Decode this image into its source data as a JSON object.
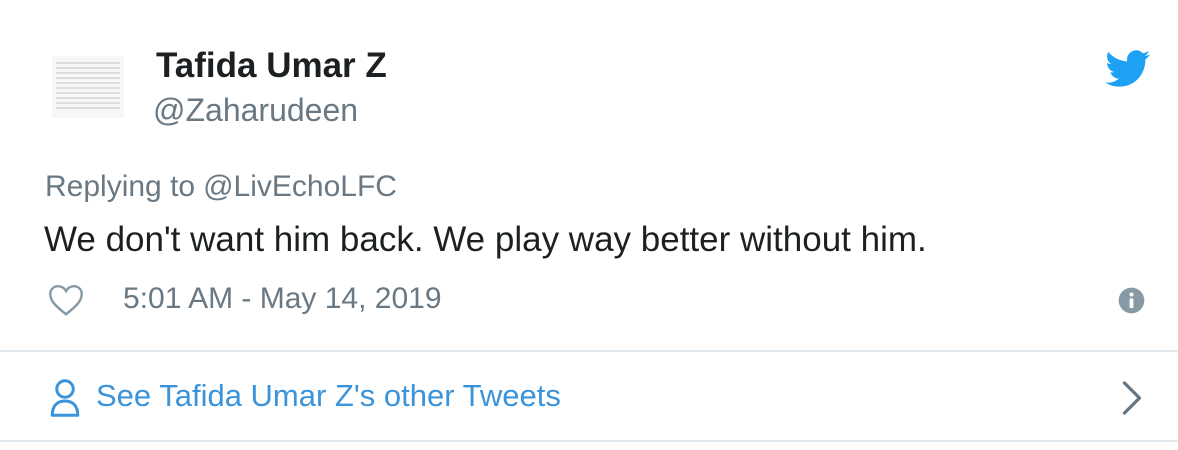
{
  "author": {
    "display_name": "Tafida Umar Z",
    "screen_name": "@Zaharudeen",
    "avatar_icon": "avatar-image"
  },
  "reply": {
    "prefix": "Replying to",
    "handle": "@LivEchoLFC"
  },
  "tweet": {
    "text": "We don't want him back. We play way better without him.",
    "timestamp": "5:01 AM - May 14, 2019"
  },
  "footer": {
    "label": "See Tafida Umar Z's other Tweets"
  },
  "icons": {
    "brand": "twitter-bird-icon",
    "like": "heart-icon",
    "info": "info-icon",
    "person": "person-icon",
    "chevron": "chevron-right-icon"
  },
  "colors": {
    "brand_blue": "#1da1f2",
    "link_blue": "#3b94d9",
    "text_primary": "#1c2022",
    "text_secondary": "#697882",
    "divider": "#e1e8ed"
  }
}
